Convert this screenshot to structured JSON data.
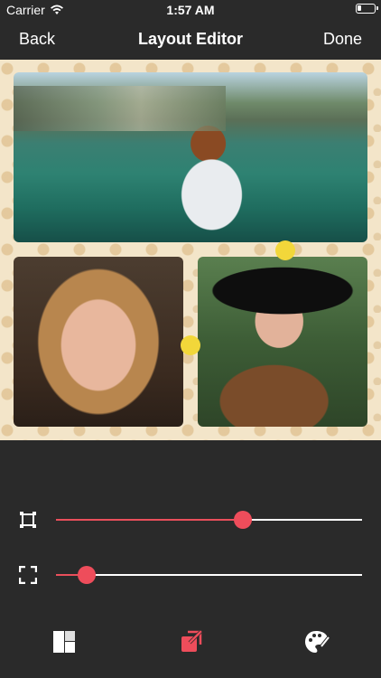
{
  "status_bar": {
    "carrier": "Carrier",
    "time": "1:57 AM",
    "battery_level": 0.25
  },
  "nav": {
    "back_label": "Back",
    "title": "Layout Editor",
    "done_label": "Done"
  },
  "canvas": {
    "photos": [
      {
        "name": "photo-lake-woman"
      },
      {
        "name": "photo-blonde-portrait"
      },
      {
        "name": "photo-hat-portrait"
      }
    ]
  },
  "sliders": {
    "border_width": {
      "icon": "frame-border-icon",
      "value": 0.61
    },
    "corner_radius": {
      "icon": "corners-icon",
      "value": 0.1
    }
  },
  "toolbar": {
    "layout_icon": "layout-icon",
    "export_icon": "export-icon",
    "palette_icon": "palette-icon"
  },
  "colors": {
    "background": "#2a2a2a",
    "accent": "#ee4d5b",
    "handle": "#f2d73a",
    "track": "#ffffff",
    "text": "#ffffff"
  }
}
